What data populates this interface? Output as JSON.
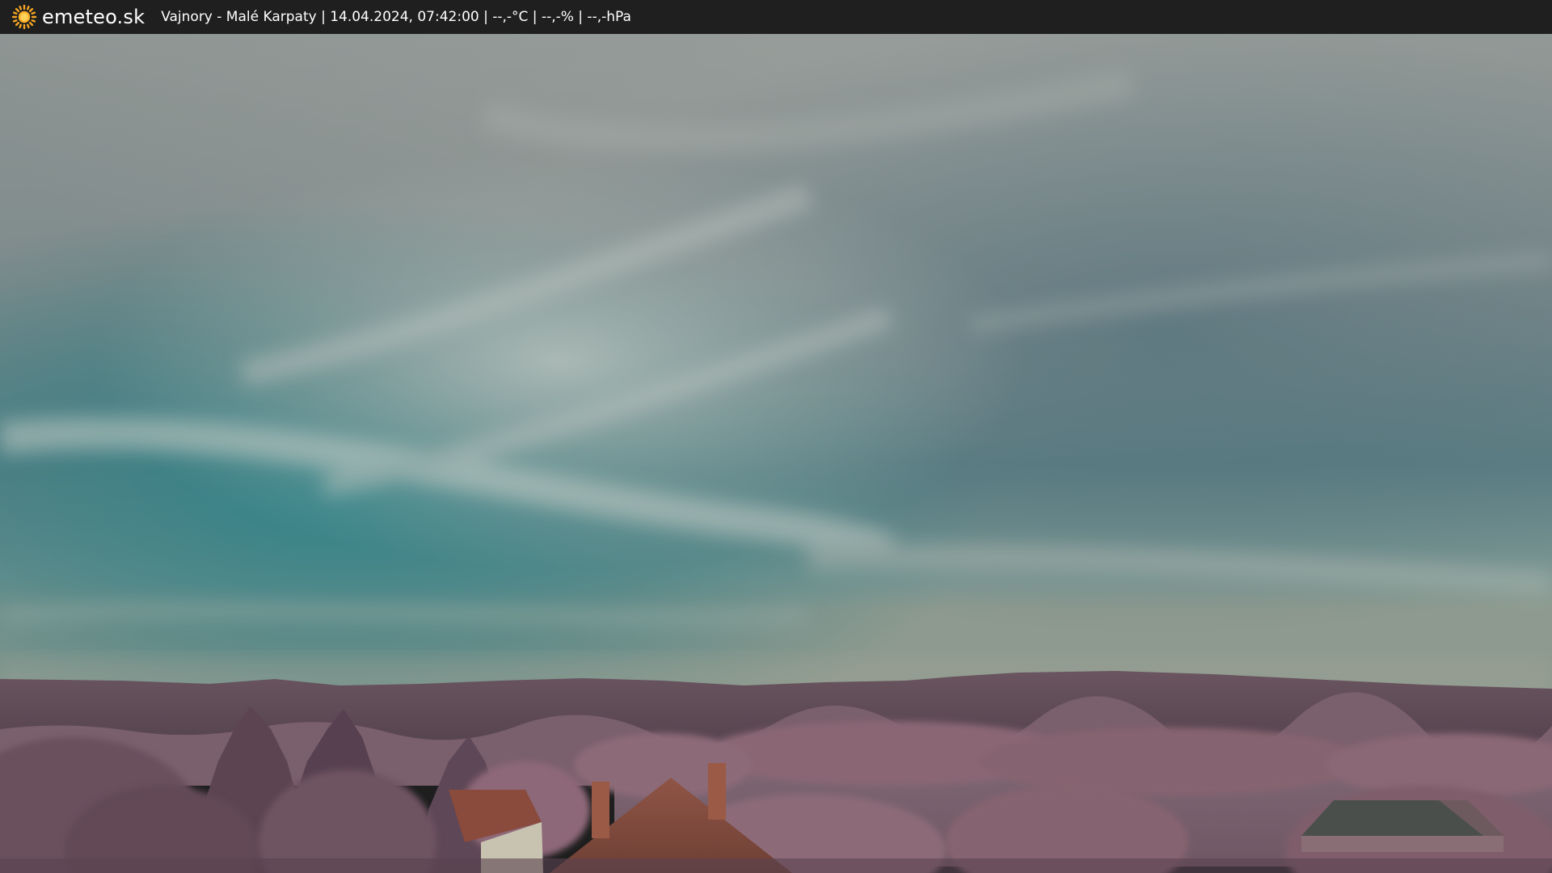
{
  "header": {
    "brand": "emeteo.sk",
    "logo_icon": "sun-icon",
    "caption": "Vajnory - Malé Karpaty | 14.04.2024, 07:42:00 | --,-°C | --,-% | --,-hPa"
  },
  "colors": {
    "bar": "#1f1f1f",
    "sun": "#f5a623",
    "sky_teal": "#3e8586",
    "sky_grey": "#8f9794",
    "hills": "#5e4a55",
    "foliage": "#9a6f7f",
    "roof": "#8a4a3c"
  }
}
